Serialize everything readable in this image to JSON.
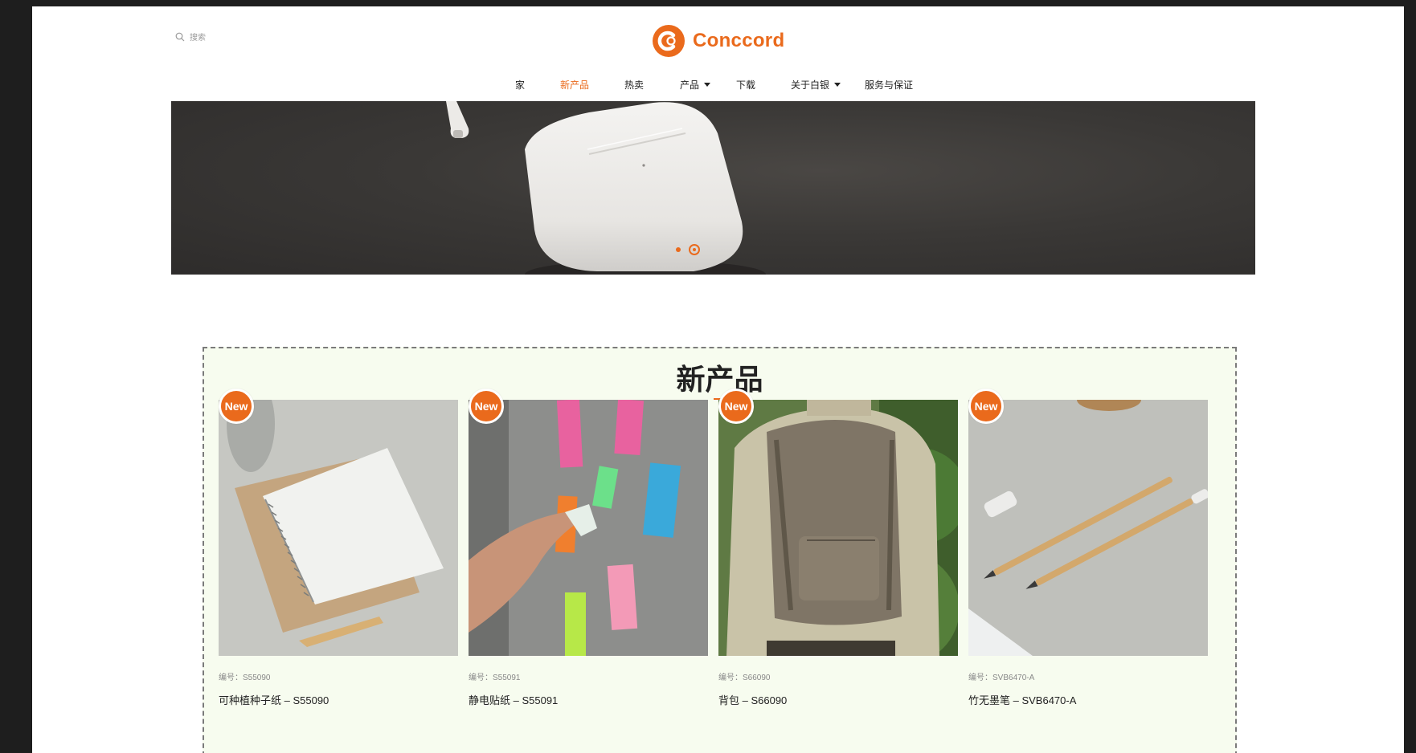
{
  "search": {
    "placeholder": "搜索"
  },
  "logo": {
    "text": "Conccord"
  },
  "nav": {
    "items": [
      {
        "label": "家"
      },
      {
        "label": "新产品"
      },
      {
        "label": "热卖"
      },
      {
        "label": "产品"
      },
      {
        "label": "下载"
      },
      {
        "label": "关于白银"
      },
      {
        "label": "服务与保证"
      }
    ]
  },
  "banner": {
    "slides": 2,
    "active_slide": 2
  },
  "section": {
    "title": "新产品"
  },
  "products": [
    {
      "badge": "New",
      "code": "编号：S55090",
      "name": "可种植种子纸 – S55090"
    },
    {
      "badge": "New",
      "code": "编号：S55091",
      "name": "静电贴纸 – S55091"
    },
    {
      "badge": "New",
      "code": "编号：S66090",
      "name": "背包 – S66090"
    },
    {
      "badge": "New",
      "code": "编号：SVB6470-A",
      "name": "竹无墨笔 – SVB6470-A"
    }
  ],
  "colors": {
    "accent": "#ea6a1c",
    "section_bg": "#f7fcef",
    "frame": "#1e1e1e"
  }
}
